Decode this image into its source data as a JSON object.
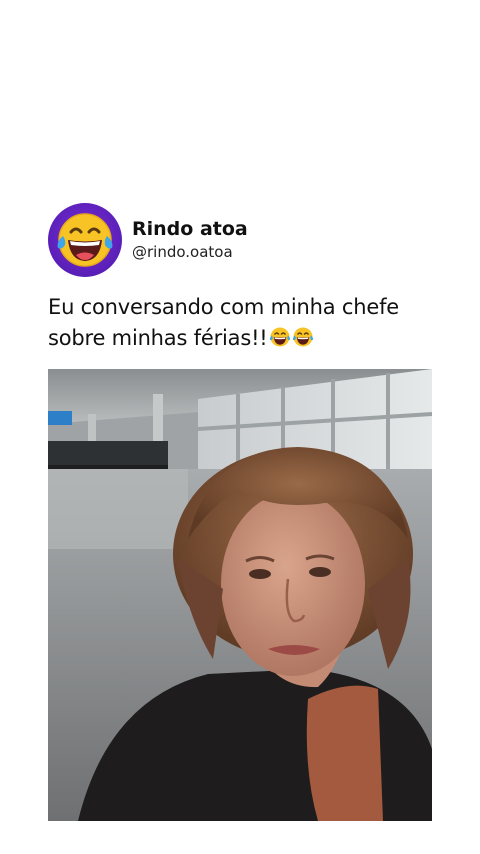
{
  "post": {
    "display_name": "Rindo atoa",
    "handle": "@rindo.oatoa",
    "avatar_icon": "laughing-tears-emoji-icon",
    "caption_line1": "Eu conversando com minha chefe",
    "caption_line2": "sobre minhas férias!!",
    "caption_emojis": [
      "laughing-tears-emoji-icon",
      "laughing-tears-emoji-icon"
    ]
  },
  "media": {
    "type": "video-frame",
    "scene": "woman-in-airport-terminal"
  },
  "colors": {
    "avatar_background": "#5a1fb8",
    "emoji_face": "#f7c325",
    "tears": "#3ea6e8",
    "text": "#111111"
  }
}
